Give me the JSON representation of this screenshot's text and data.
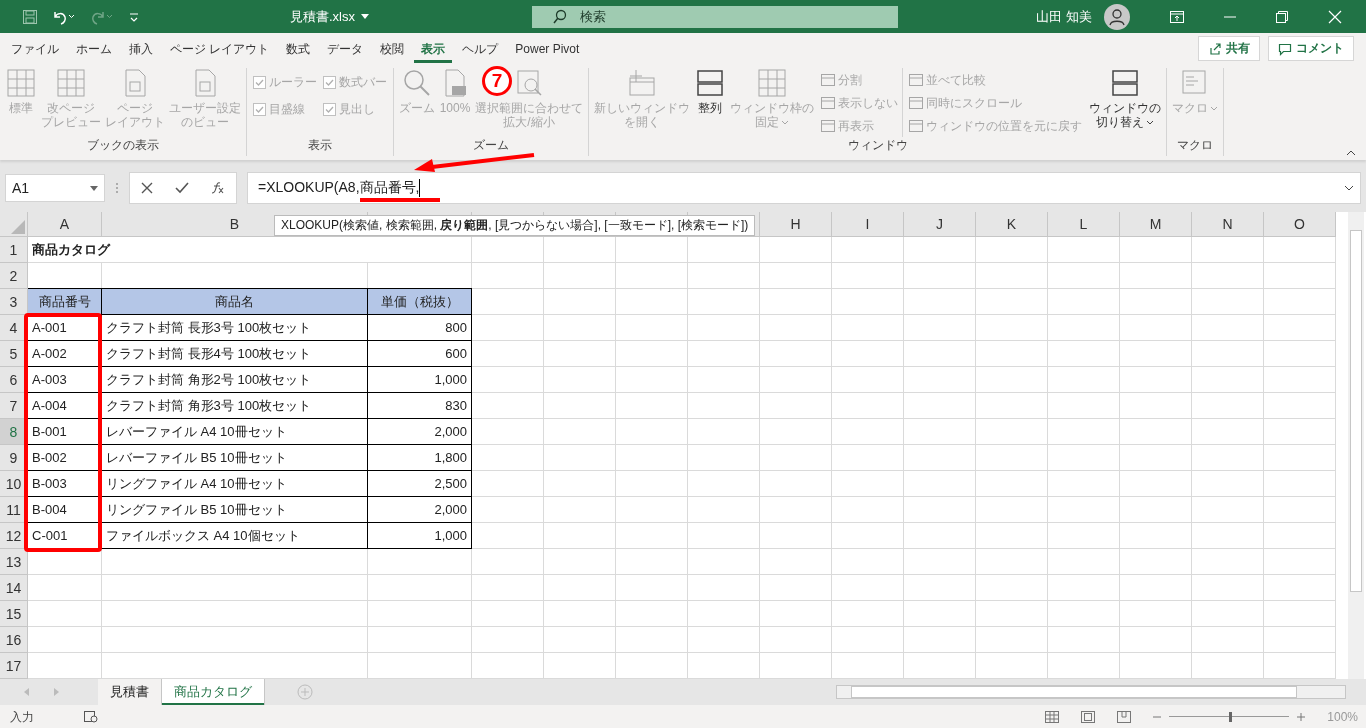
{
  "title_bar": {
    "file_name": "見積書.xlsx",
    "search": {
      "placeholder": "検索"
    },
    "user_name": "山田 知美"
  },
  "ribbon_tabs": [
    {
      "label": "ファイル",
      "selected": false
    },
    {
      "label": "ホーム",
      "selected": false
    },
    {
      "label": "挿入",
      "selected": false
    },
    {
      "label": "ページ レイアウト",
      "selected": false
    },
    {
      "label": "数式",
      "selected": false
    },
    {
      "label": "データ",
      "selected": false
    },
    {
      "label": "校閲",
      "selected": false
    },
    {
      "label": "表示",
      "selected": true
    },
    {
      "label": "ヘルプ",
      "selected": false
    },
    {
      "label": "Power Pivot",
      "selected": false
    }
  ],
  "share_button": "共有",
  "comment_button": "コメント",
  "ribbon_groups": [
    {
      "label": "ブックの表示",
      "controls": [
        {
          "kind": "large",
          "lines": [
            "標準"
          ],
          "disabled": true
        },
        {
          "kind": "large",
          "lines": [
            "改ページ",
            "プレビュー"
          ],
          "disabled": true
        },
        {
          "kind": "large",
          "lines": [
            "ページ",
            "レイアウト"
          ],
          "disabled": true
        },
        {
          "kind": "large",
          "lines": [
            "ユーザー設定",
            "のビュー"
          ],
          "disabled": true
        }
      ]
    },
    {
      "label": "表示",
      "controls": [
        {
          "kind": "checkbox",
          "label": "ルーラー",
          "checked": true,
          "disabled": true
        },
        {
          "kind": "checkbox",
          "label": "目盛線",
          "checked": true,
          "disabled": true
        },
        {
          "kind": "checkbox",
          "label": "数式バー",
          "checked": true,
          "disabled": true
        },
        {
          "kind": "checkbox",
          "label": "見出し",
          "checked": true,
          "disabled": true
        }
      ]
    },
    {
      "label": "ズーム",
      "controls": [
        {
          "kind": "large",
          "lines": [
            "ズーム"
          ],
          "disabled": true
        },
        {
          "kind": "large",
          "lines": [
            "100%"
          ],
          "disabled": true
        },
        {
          "kind": "large",
          "lines": [
            "選択範囲に合わせて",
            "拡大/縮小"
          ],
          "disabled": true
        }
      ]
    },
    {
      "label": "ウィンドウ",
      "controls": [
        {
          "kind": "large",
          "lines": [
            "新しいウィンドウ",
            "を開く"
          ],
          "disabled": true
        },
        {
          "kind": "large",
          "lines": [
            "整列"
          ],
          "disabled": false
        },
        {
          "kind": "large",
          "lines": [
            "ウィンドウ枠の",
            "固定"
          ],
          "dropdown": true,
          "disabled": true
        },
        {
          "kind": "small",
          "label": "分割",
          "disabled": true
        },
        {
          "kind": "small",
          "label": "表示しない",
          "disabled": true
        },
        {
          "kind": "small",
          "label": "再表示",
          "disabled": true
        },
        {
          "kind": "small",
          "label": "並べて比較",
          "disabled": true
        },
        {
          "kind": "small",
          "label": "同時にスクロール",
          "disabled": true
        },
        {
          "kind": "small",
          "label": "ウィンドウの位置を元に戻す",
          "disabled": true
        },
        {
          "kind": "large",
          "lines": [
            "ウィンドウの",
            "切り替え"
          ],
          "dropdown": true,
          "disabled": false
        }
      ]
    },
    {
      "label": "マクロ",
      "controls": [
        {
          "kind": "large",
          "lines": [
            "マクロ"
          ],
          "dropdown": true,
          "disabled": true
        }
      ]
    }
  ],
  "formula_bar": {
    "name_box": "A1",
    "formula": "=XLOOKUP(A8,商品番号,"
  },
  "tooltip": "XLOOKUP(検索値, 検索範囲, **戻り範囲**, [見つからない場合], [一致モード], [検索モード])",
  "columns": [
    "A",
    "B",
    null,
    null,
    null,
    null,
    null,
    "H",
    "I",
    "J",
    "K",
    "L",
    "M",
    "N",
    "O"
  ],
  "rows": [
    {
      "header": "1",
      "selected": false,
      "kind": "title",
      "cells": [
        "商品カタログ"
      ]
    },
    {
      "header": "2",
      "selected": false,
      "kind": "empty",
      "cells": []
    },
    {
      "header": "3",
      "selected": false,
      "kind": "table_header",
      "cells": [
        "商品番号",
        "商品名",
        "単価（税抜）"
      ]
    },
    {
      "header": "4",
      "selected": false,
      "kind": "data",
      "cells": [
        "A-001",
        "クラフト封筒 長形3号 100枚セット",
        "800"
      ]
    },
    {
      "header": "5",
      "selected": false,
      "kind": "data",
      "cells": [
        "A-002",
        "クラフト封筒 長形4号 100枚セット",
        "600"
      ]
    },
    {
      "header": "6",
      "selected": false,
      "kind": "data",
      "cells": [
        "A-003",
        "クラフト封筒 角形2号 100枚セット",
        "1,000"
      ]
    },
    {
      "header": "7",
      "selected": false,
      "kind": "data",
      "cells": [
        "A-004",
        "クラフト封筒 角形3号 100枚セット",
        "830"
      ]
    },
    {
      "header": "8",
      "selected": true,
      "kind": "data",
      "cells": [
        "B-001",
        "レバーファイル A4 10冊セット",
        "2,000"
      ]
    },
    {
      "header": "9",
      "selected": false,
      "kind": "data",
      "cells": [
        "B-002",
        "レバーファイル B5 10冊セット",
        "1,800"
      ]
    },
    {
      "header": "10",
      "selected": false,
      "kind": "data",
      "cells": [
        "B-003",
        "リングファイル A4 10冊セット",
        "2,500"
      ]
    },
    {
      "header": "11",
      "selected": false,
      "kind": "data",
      "cells": [
        "B-004",
        "リングファイル B5 10冊セット",
        "2,000"
      ]
    },
    {
      "header": "12",
      "selected": false,
      "kind": "data",
      "cells": [
        "C-001",
        "ファイルボックス A4 10個セット",
        "1,000"
      ]
    },
    {
      "header": "13",
      "selected": false,
      "kind": "empty",
      "cells": []
    },
    {
      "header": "14",
      "selected": false,
      "kind": "empty",
      "cells": []
    },
    {
      "header": "15",
      "selected": false,
      "kind": "empty",
      "cells": []
    },
    {
      "header": "16",
      "selected": false,
      "kind": "empty",
      "cells": []
    },
    {
      "header": "17",
      "selected": false,
      "kind": "empty",
      "cells": []
    }
  ],
  "sheet_tabs": [
    {
      "label": "見積書",
      "selected": false
    },
    {
      "label": "商品カタログ",
      "selected": true
    }
  ],
  "status_bar": {
    "mode": "入力",
    "zoom": {
      "level": 0.5,
      "reading": "100%"
    }
  },
  "annotation": {
    "step": "7"
  }
}
